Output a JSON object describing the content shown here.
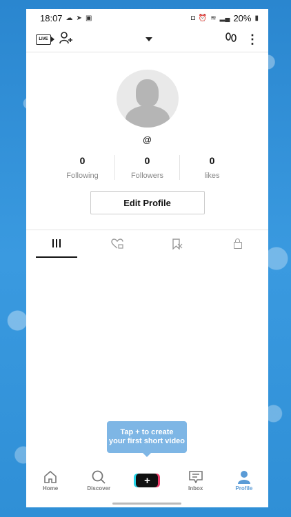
{
  "status_bar": {
    "time": "18:07",
    "battery": "20%"
  },
  "profile": {
    "handle": "@",
    "stats": [
      {
        "value": "0",
        "label": "Following"
      },
      {
        "value": "0",
        "label": "Followers"
      },
      {
        "value": "0",
        "label": "likes"
      }
    ],
    "edit_button": "Edit Profile"
  },
  "tabs": [
    "videos-grid-icon",
    "liked-icon",
    "favorites-icon",
    "private-lock-icon"
  ],
  "tooltip": {
    "line1": "Tap + to create",
    "line2": "your first short video"
  },
  "bottom_nav": {
    "home": "Home",
    "discover": "Discover",
    "create": "+",
    "inbox": "Inbox",
    "profile": "Profile"
  },
  "colors": {
    "accent": "#5a9bd6",
    "tooltip": "#7eb6e5"
  }
}
